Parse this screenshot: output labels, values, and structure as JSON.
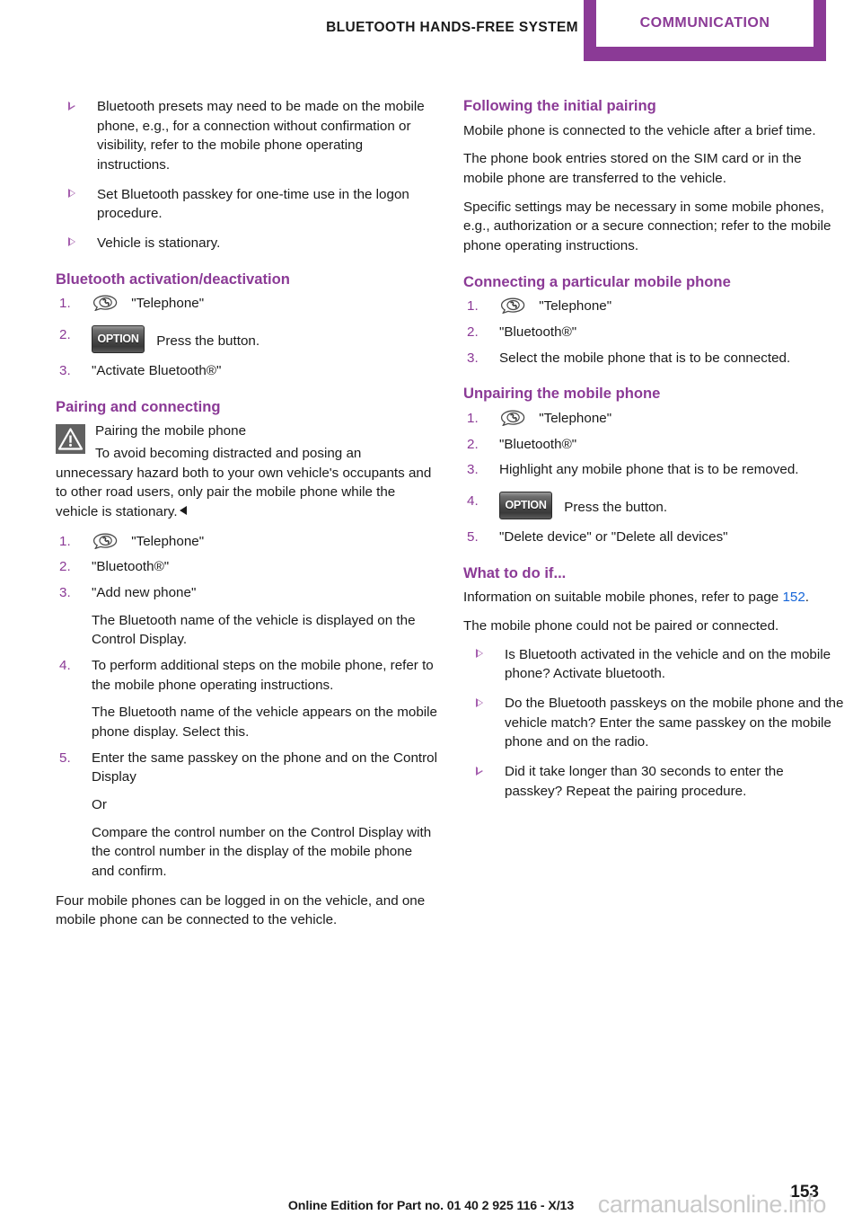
{
  "header": {
    "running_title": "Bluetooth hands-free system",
    "tab_label": "Communication",
    "accent_color": "#8b3a96"
  },
  "icons": {
    "telephone": "telephone-icon",
    "option_button_label": "OPTION",
    "warning": "warning-triangle-icon"
  },
  "left_column": {
    "intro_bullets": [
      "Bluetooth presets may need to be made on the mobile phone, e.g., for a connection without confirmation or visibility, refer to the mobile phone operating instructions.",
      "Set Bluetooth passkey for one-time use in the logon procedure.",
      "Vehicle is stationary."
    ],
    "activation": {
      "heading": "Bluetooth activation/deactivation",
      "steps": [
        {
          "num": "1.",
          "icon": "telephone",
          "text": "\"Telephone\""
        },
        {
          "num": "2.",
          "icon": "option",
          "text": "Press the button."
        },
        {
          "num": "3.",
          "icon": "none",
          "text": "\"Activate Bluetooth®\""
        }
      ]
    },
    "pairing": {
      "heading": "Pairing and connecting",
      "warning_title": "Pairing the mobile phone",
      "warning_body": "To avoid becoming distracted and posing an unnecessary hazard both to your own vehicle's occupants and to other road users, only pair the mobile phone while the vehicle is stationary.",
      "steps": [
        {
          "num": "1.",
          "icon": "telephone",
          "text": "\"Telephone\""
        },
        {
          "num": "2.",
          "icon": "none",
          "text": "\"Bluetooth®\""
        },
        {
          "num": "3.",
          "icon": "none",
          "text": "\"Add new phone\""
        },
        {
          "num": "",
          "icon": "none",
          "text": "The Bluetooth name of the vehicle is displayed on the Control Display."
        },
        {
          "num": "4.",
          "icon": "none",
          "text": "To perform additional steps on the mobile phone, refer to the mobile phone operating instructions."
        },
        {
          "num": "",
          "icon": "none",
          "text": "The Bluetooth name of the vehicle appears on the mobile phone display. Select this."
        },
        {
          "num": "5.",
          "icon": "none",
          "text": "Enter the same passkey on the phone and on the Control Display"
        },
        {
          "num": "",
          "icon": "none",
          "text": "Or"
        },
        {
          "num": "",
          "icon": "none",
          "text": "Compare the control number on the Control Display with the control number in the display of the mobile phone and confirm."
        }
      ],
      "closing_para": "Four mobile phones can be logged in on the vehicle, and one mobile phone can be connected to the vehicle."
    }
  },
  "right_column": {
    "following_pairing": {
      "heading": "Following the initial pairing",
      "paragraphs": [
        "Mobile phone is connected to the vehicle after a brief time.",
        "The phone book entries stored on the SIM card or in the mobile phone are transferred to the vehicle.",
        "Specific settings may be necessary in some mobile phones, e.g., authorization or a secure connection; refer to the mobile phone operating instructions."
      ]
    },
    "connecting": {
      "heading": "Connecting a particular mobile phone",
      "steps": [
        {
          "num": "1.",
          "icon": "telephone",
          "text": "\"Telephone\""
        },
        {
          "num": "2.",
          "icon": "none",
          "text": "\"Bluetooth®\""
        },
        {
          "num": "3.",
          "icon": "none",
          "text": "Select the mobile phone that is to be connected."
        }
      ]
    },
    "unpairing": {
      "heading": "Unpairing the mobile phone",
      "steps": [
        {
          "num": "1.",
          "icon": "telephone",
          "text": "\"Telephone\""
        },
        {
          "num": "2.",
          "icon": "none",
          "text": "\"Bluetooth®\""
        },
        {
          "num": "3.",
          "icon": "none",
          "text": "Highlight any mobile phone that is to be removed."
        },
        {
          "num": "4.",
          "icon": "option",
          "text": "Press the button."
        },
        {
          "num": "5.",
          "icon": "none",
          "text": "\"Delete device\" or \"Delete all devices\""
        }
      ]
    },
    "what_to_do": {
      "heading": "What to do if...",
      "info_prefix": "Information on suitable mobile phones, refer to page ",
      "info_page_ref": "152",
      "info_suffix": ".",
      "problem": "The mobile phone could not be paired or connected.",
      "bullets": [
        "Is Bluetooth activated in the vehicle and on the mobile phone? Activate bluetooth.",
        "Do the Bluetooth passkeys on the mobile phone and the vehicle match? Enter the same passkey on the mobile phone and on the radio.",
        "Did it take longer than 30 seconds to enter the passkey? Repeat the pairing procedure."
      ]
    }
  },
  "footer": {
    "edition": "Online Edition for Part no. 01 40 2 925 116 - X/13",
    "page_number": "153",
    "watermark": "carmanualsonline.info"
  }
}
